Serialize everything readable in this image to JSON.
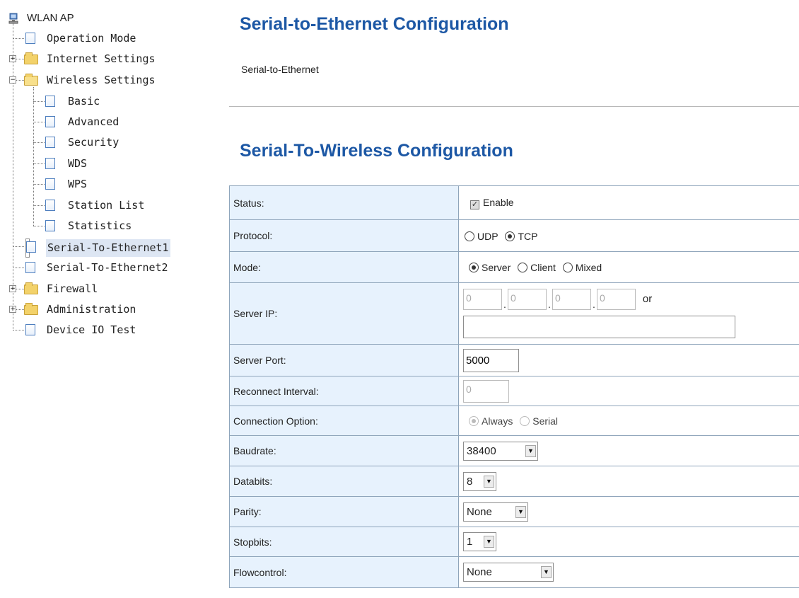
{
  "tree": {
    "root": "WLAN AP",
    "items": [
      {
        "label": "Operation Mode"
      },
      {
        "label": "Internet Settings"
      },
      {
        "label": "Wireless Settings"
      },
      {
        "label": "Basic"
      },
      {
        "label": "Advanced"
      },
      {
        "label": "Security"
      },
      {
        "label": "WDS"
      },
      {
        "label": "WPS"
      },
      {
        "label": "Station List"
      },
      {
        "label": "Statistics"
      },
      {
        "label": "Serial-To-Ethernet1"
      },
      {
        "label": "Serial-To-Ethernet2"
      },
      {
        "label": "Firewall"
      },
      {
        "label": "Administration"
      },
      {
        "label": "Device IO Test"
      }
    ],
    "selected": "Serial-To-Ethernet1"
  },
  "page": {
    "title": "Serial-to-Ethernet Configuration",
    "subtitle": "Serial-to-Ethernet",
    "section_title": "Serial-To-Wireless Configuration"
  },
  "form": {
    "status": {
      "label": "Status:",
      "option": "Enable",
      "checked": true
    },
    "protocol": {
      "label": "Protocol:",
      "options": [
        "UDP",
        "TCP"
      ],
      "selected": "TCP"
    },
    "mode": {
      "label": "Mode:",
      "options": [
        "Server",
        "Client",
        "Mixed"
      ],
      "selected": "Server"
    },
    "server_ip": {
      "label": "Server IP:",
      "octets": [
        "0",
        "0",
        "0",
        "0"
      ],
      "or_text": "or",
      "hostname": ""
    },
    "server_port": {
      "label": "Server Port:",
      "value": "5000"
    },
    "reconnect_interval": {
      "label": "Reconnect Interval:",
      "value": "0"
    },
    "connection_option": {
      "label": "Connection Option:",
      "options": [
        "Always",
        "Serial"
      ],
      "selected": "Always"
    },
    "baudrate": {
      "label": "Baudrate:",
      "value": "38400"
    },
    "databits": {
      "label": "Databits:",
      "value": "8"
    },
    "parity": {
      "label": "Parity:",
      "value": "None"
    },
    "stopbits": {
      "label": "Stopbits:",
      "value": "1"
    },
    "flowcontrol": {
      "label": "Flowcontrol:",
      "value": "None"
    }
  }
}
